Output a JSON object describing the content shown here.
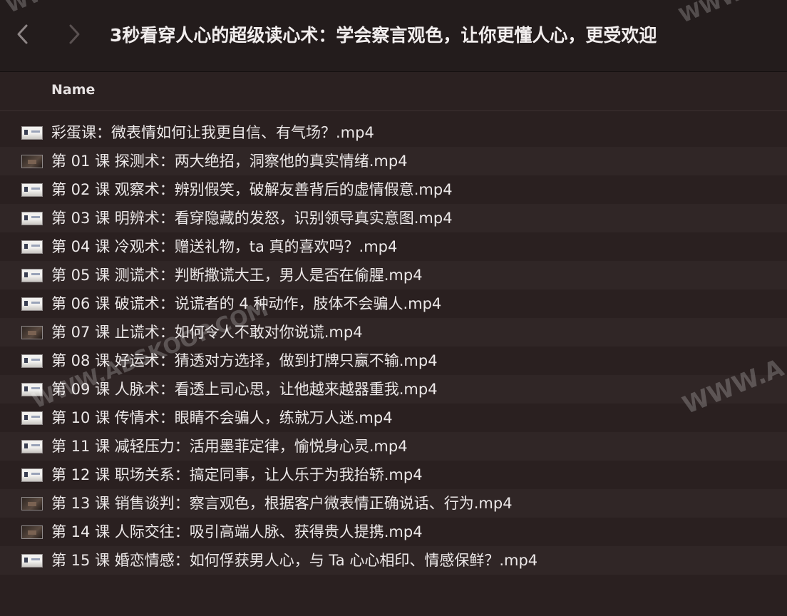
{
  "window": {
    "title": "3秒看穿人心的超级读心术：学会察言观色，让你更懂人心，更受欢迎"
  },
  "toolbar": {
    "back_icon": "chevron-left-icon",
    "forward_icon": "chevron-right-icon"
  },
  "list": {
    "column_header": "Name",
    "files": [
      {
        "name": "彩蛋课：微表情如何让我更自信、有气场？.mp4",
        "thumb": "light"
      },
      {
        "name": "第 01 课 探测术：两大绝招，洞察他的真实情绪.mp4",
        "thumb": "dark"
      },
      {
        "name": "第 02 课 观察术：辨别假笑，破解友善背后的虚情假意.mp4",
        "thumb": "light"
      },
      {
        "name": "第 03 课 明辨术：看穿隐藏的发怒，识别领导真实意图.mp4",
        "thumb": "light"
      },
      {
        "name": "第 04 课 冷观术：赠送礼物，ta 真的喜欢吗？.mp4",
        "thumb": "light"
      },
      {
        "name": "第 05 课 测谎术：判断撒谎大王，男人是否在偷腥.mp4",
        "thumb": "light"
      },
      {
        "name": "第 06 课 破谎术：说谎者的 4 种动作，肢体不会骗人.mp4",
        "thumb": "light"
      },
      {
        "name": "第 07 课 止谎术：如何令人不敢对你说谎.mp4",
        "thumb": "dark"
      },
      {
        "name": "第 08 课 好运术：猜透对方选择，做到打牌只赢不输.mp4",
        "thumb": "light"
      },
      {
        "name": "第 09 课 人脉术：看透上司心思，让他越来越器重我.mp4",
        "thumb": "light"
      },
      {
        "name": "第 10 课 传情术：眼睛不会骗人，练就万人迷.mp4",
        "thumb": "light"
      },
      {
        "name": "第 11 课 减轻压力：活用墨菲定律，愉悦身心灵.mp4",
        "thumb": "light"
      },
      {
        "name": "第 12 课 职场关系：搞定同事，让人乐于为我抬轿.mp4",
        "thumb": "light"
      },
      {
        "name": "第 13 课 销售谈判：察言观色，根据客户微表情正确说话、行为.mp4",
        "thumb": "dark"
      },
      {
        "name": "第 14 课 人际交往：吸引高端人脉、获得贵人提携.mp4",
        "thumb": "dark"
      },
      {
        "name": "第 15 课 婚恋情感：如何俘获男人心，与 Ta 心心相印、情感保鲜？.mp4",
        "thumb": "light"
      }
    ]
  },
  "watermarks": {
    "center": "WWW.ABSKOOP.COM",
    "right": "WWW.A",
    "top_left": "WWW",
    "top_right": "WWW"
  },
  "colors": {
    "background": "#2a2020",
    "toolbar": "#231c1c",
    "alt_row": "#302626",
    "text": "#ece8e8"
  }
}
